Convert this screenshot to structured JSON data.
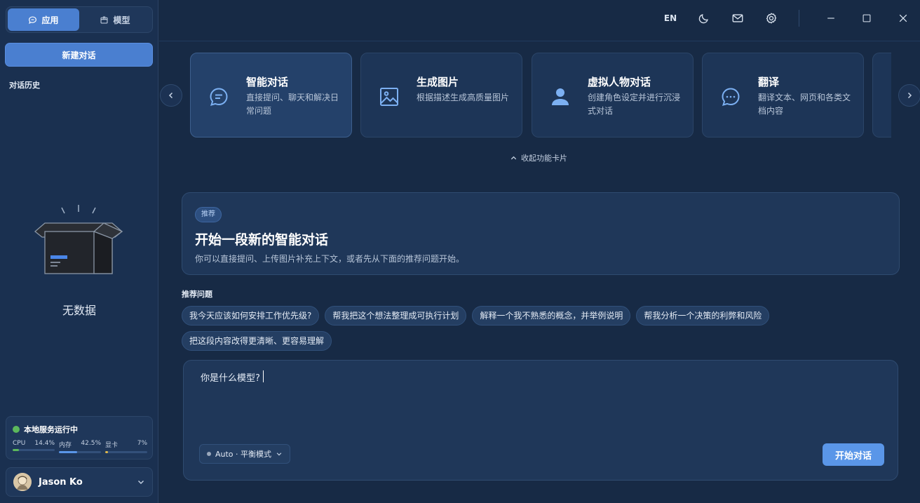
{
  "sidebar": {
    "tabs": [
      {
        "label": "应用",
        "icon": "chat-bubble-icon",
        "active": true
      },
      {
        "label": "模型",
        "icon": "box-icon",
        "active": false
      }
    ],
    "new_chat_label": "新建对话",
    "history_title": "对话历史",
    "empty_text": "无数据",
    "status": {
      "label": "本地服务运行中",
      "color": "#5cb85c",
      "metrics": [
        {
          "name": "CPU",
          "value": "14.4%",
          "fraction": 0.144,
          "color": "#5cb85c"
        },
        {
          "name": "内存",
          "value": "42.5%",
          "fraction": 0.425,
          "color": "#5a96e8"
        },
        {
          "name": "显卡",
          "value": "7%",
          "fraction": 0.07,
          "color": "#e0b84a"
        }
      ]
    },
    "user": {
      "name": "Jason Ko"
    }
  },
  "topbar": {
    "lang": "EN",
    "icons": [
      "moon-icon",
      "mail-icon",
      "settings-icon",
      "minimize-icon",
      "maximize-icon",
      "close-icon"
    ]
  },
  "cards": [
    {
      "title": "智能对话",
      "desc": "直接提问、聊天和解决日常问题",
      "icon": "chat-icon",
      "active": true
    },
    {
      "title": "生成图片",
      "desc": "根据描述生成高质量图片",
      "icon": "image-icon",
      "active": false
    },
    {
      "title": "虚拟人物对话",
      "desc": "创建角色设定并进行沉浸式对话",
      "icon": "person-icon",
      "active": false
    },
    {
      "title": "翻译",
      "desc": "翻译文本、网页和各类文档内容",
      "icon": "dots-bubble-icon",
      "active": false
    }
  ],
  "collapse_label": "收起功能卡片",
  "hero": {
    "badge": "推荐",
    "title": "开始一段新的智能对话",
    "desc": "你可以直接提问、上传图片补充上下文，或者先从下面的推荐问题开始。"
  },
  "suggestions": {
    "title": "推荐问题",
    "items": [
      "我今天应该如何安排工作优先级?",
      "帮我把这个想法整理成可执行计划",
      "解释一个我不熟悉的概念，并举例说明",
      "帮我分析一个决策的利弊和风险",
      "把这段内容改得更清晰、更容易理解"
    ]
  },
  "composer": {
    "value": "你是什么模型?",
    "mode": "Auto · 平衡模式",
    "send_label": "开始对话"
  },
  "colors": {
    "accent": "#4a7fd0",
    "send": "#5a96e8",
    "background": "#172a45"
  }
}
